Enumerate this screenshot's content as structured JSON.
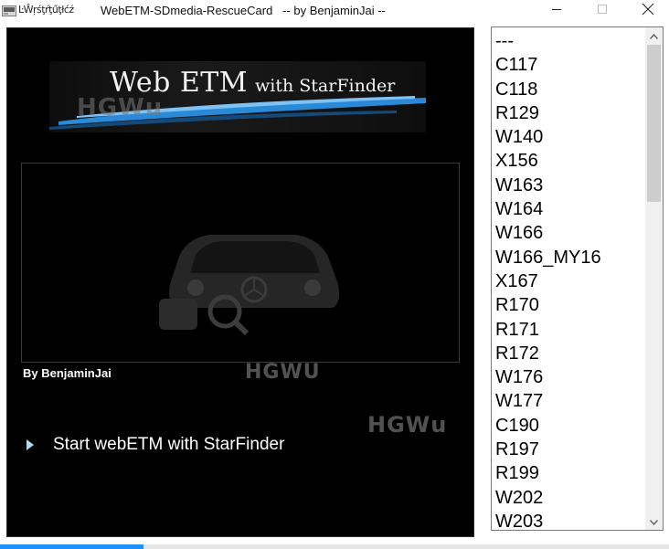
{
  "window": {
    "title_garbled": "ĿŴŗśţŕţűţłćź",
    "title": "WebETM-SDmedia-RescueCard   -- by BenjaminJai --",
    "icons": {
      "app": "app-icon",
      "minimize": "minimize-icon",
      "maximize": "maximize-icon",
      "close": "close-icon"
    }
  },
  "banner": {
    "title": "Web ETM",
    "subtitle": "with StarFinder",
    "watermark": "HGWu"
  },
  "watermarks": [
    "HGWU",
    "HGWu"
  ],
  "author_label": "By BenjaminJai",
  "start_button": {
    "label": "Start webETM with StarFinder",
    "icon": "play-arrow-icon"
  },
  "model_list": {
    "items": [
      "---",
      "C117",
      "C118",
      "R129",
      "W140",
      "X156",
      "W163",
      "W164",
      "W166",
      "W166_MY16",
      "X167",
      "R170",
      "R171",
      "R172",
      "W176",
      "W177",
      "C190",
      "R197",
      "R199",
      "W202",
      "W203"
    ],
    "scroll": {
      "up_icon": "scroll-up-icon",
      "down_icon": "scroll-down-icon"
    }
  },
  "progress": {
    "value": 0.215,
    "color": "#1e90ff"
  },
  "colors": {
    "panel_bg": "#000000",
    "accent_blue": "#1e90ff",
    "banner_swoosh": "#2a8ad8"
  }
}
